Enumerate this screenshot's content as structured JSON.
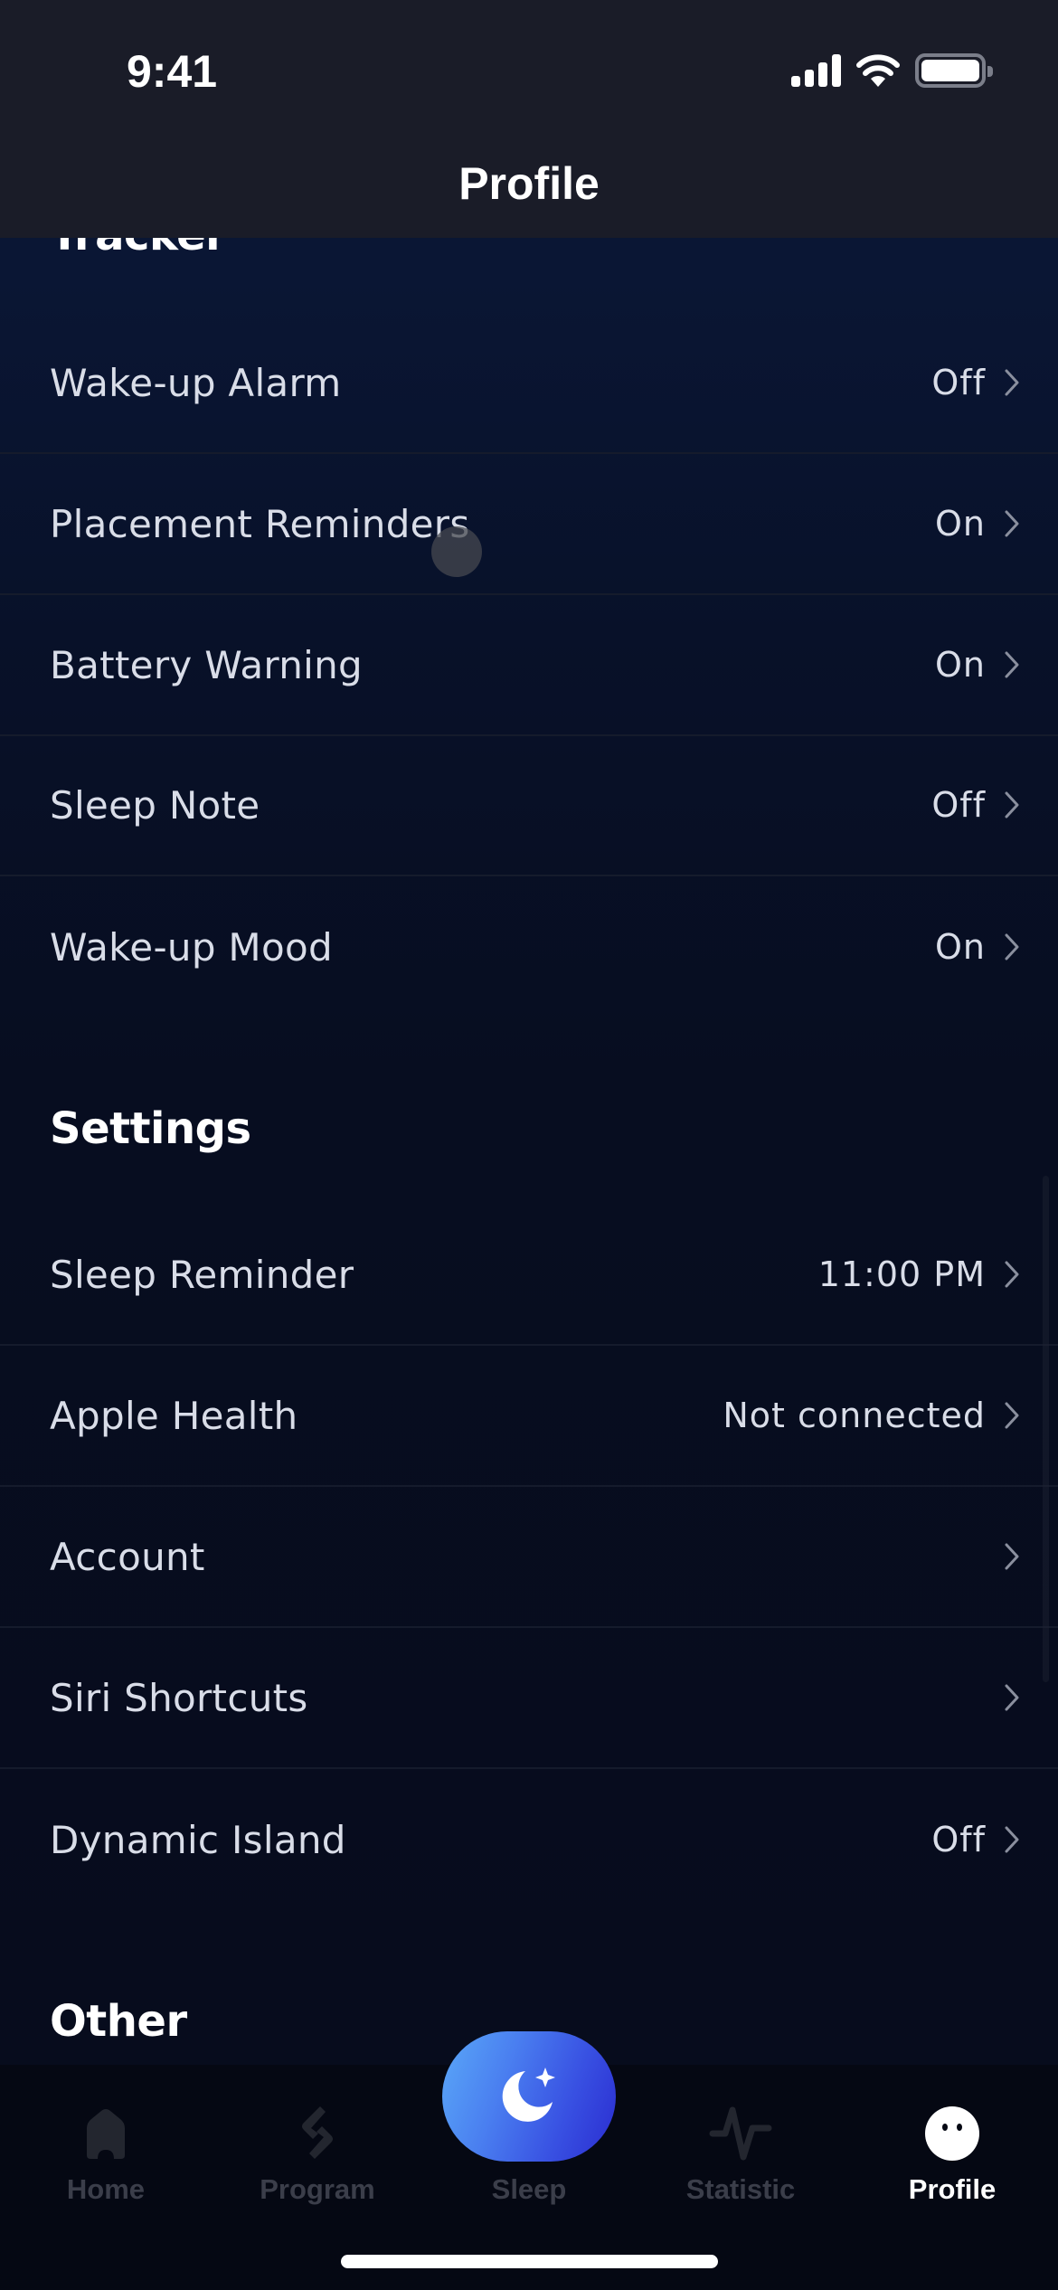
{
  "status_bar": {
    "time": "9:41",
    "signal_icon": "cellular-signal-icon",
    "wifi_icon": "wifi-icon",
    "battery_icon": "battery-full-icon"
  },
  "header": {
    "title": "Profile"
  },
  "sections": {
    "tracker": {
      "heading": "Tracker",
      "items": [
        {
          "label": "Wake-up Alarm",
          "value": "Off"
        },
        {
          "label": "Placement Reminders",
          "value": "On"
        },
        {
          "label": "Battery Warning",
          "value": "On"
        },
        {
          "label": "Sleep Note",
          "value": "Off"
        },
        {
          "label": "Wake-up Mood",
          "value": "On"
        }
      ]
    },
    "settings": {
      "heading": "Settings",
      "items": [
        {
          "label": "Sleep Reminder",
          "value": "11:00 PM"
        },
        {
          "label": "Apple Health",
          "value": "Not connected"
        },
        {
          "label": "Account",
          "value": ""
        },
        {
          "label": "Siri Shortcuts",
          "value": ""
        },
        {
          "label": "Dynamic Island",
          "value": "Off"
        }
      ]
    },
    "other": {
      "heading": "Other"
    }
  },
  "tabbar": {
    "tabs": [
      {
        "label": "Home",
        "icon": "home-icon",
        "active": false
      },
      {
        "label": "Program",
        "icon": "program-icon",
        "active": false
      },
      {
        "label": "Sleep",
        "icon": "moon-star-icon",
        "active": false
      },
      {
        "label": "Statistic",
        "icon": "pulse-chart-icon",
        "active": false
      },
      {
        "label": "Profile",
        "icon": "profile-face-icon",
        "active": true
      }
    ]
  },
  "colors": {
    "header_bg": "#1a1c28",
    "content_bg": "#0a1634",
    "tabbar_bg": "#050813",
    "row_text": "#d9dde8",
    "inactive_tab": "#3b3e4a",
    "sleep_gradient_start": "#5aa8f8",
    "sleep_gradient_end": "#2a2cd0"
  }
}
